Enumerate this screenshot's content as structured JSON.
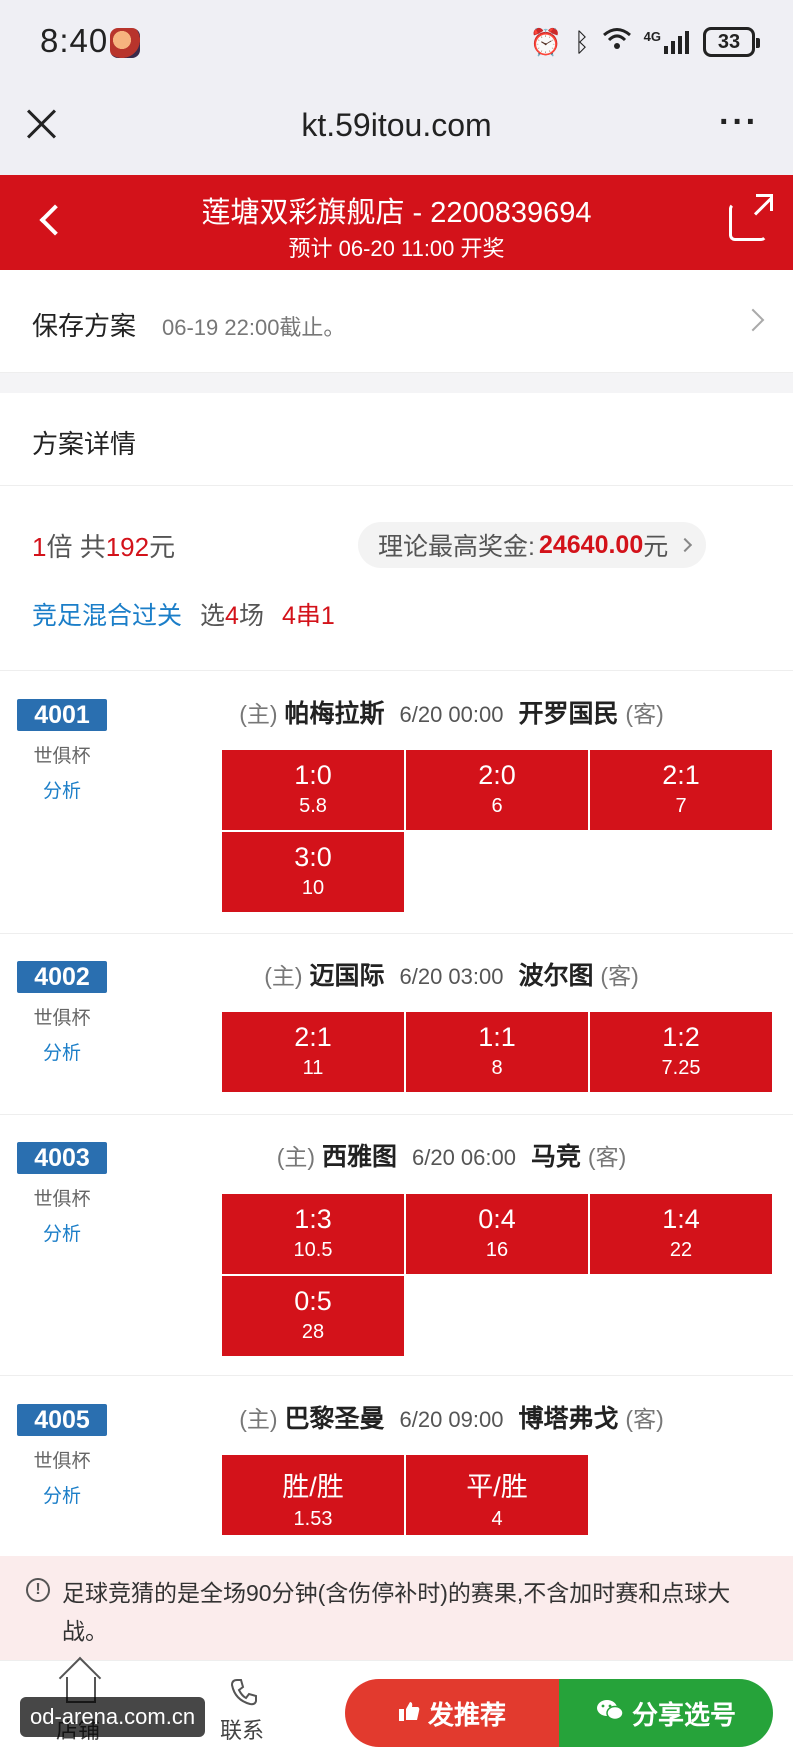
{
  "status_bar": {
    "time": "8:40",
    "network": "4G",
    "battery": "33"
  },
  "url_bar": {
    "url": "kt.59itou.com",
    "more": "···"
  },
  "header": {
    "title": "莲塘双彩旗舰店 - 2200839694",
    "subtitle": "预计 06-20 11:00 开奖"
  },
  "save_row": {
    "title": "保存方案",
    "deadline": "06-19 22:00截止。"
  },
  "detail": {
    "title": "方案详情",
    "multiplier": "1",
    "multiplier_unit": "倍 共",
    "amount": "192",
    "amount_unit": "元",
    "prize_label": "理论最高奖金:",
    "prize_value": "24640.00",
    "prize_unit": "元",
    "mode": "竞足混合过关",
    "select_pre": "选",
    "select_count": "4",
    "select_post": "场",
    "combo": "4串1"
  },
  "matches": [
    {
      "no": "4001",
      "league": "世俱杯",
      "analysis": "分析",
      "home_tag": "(主)",
      "home": "帕梅拉斯",
      "time": "6/20 00:00",
      "away": "开罗国民",
      "away_tag": "(客)",
      "picks": [
        {
          "score": "1:0",
          "odds": "5.8"
        },
        {
          "score": "2:0",
          "odds": "6"
        },
        {
          "score": "2:1",
          "odds": "7"
        },
        {
          "score": "3:0",
          "odds": "10"
        }
      ]
    },
    {
      "no": "4002",
      "league": "世俱杯",
      "analysis": "分析",
      "home_tag": "(主)",
      "home": "迈国际",
      "time": "6/20 03:00",
      "away": "波尔图",
      "away_tag": "(客)",
      "picks": [
        {
          "score": "2:1",
          "odds": "11"
        },
        {
          "score": "1:1",
          "odds": "8"
        },
        {
          "score": "1:2",
          "odds": "7.25"
        }
      ]
    },
    {
      "no": "4003",
      "league": "世俱杯",
      "analysis": "分析",
      "home_tag": "(主)",
      "home": "西雅图",
      "time": "6/20 06:00",
      "away": "马竞",
      "away_tag": "(客)",
      "picks": [
        {
          "score": "1:3",
          "odds": "10.5"
        },
        {
          "score": "0:4",
          "odds": "16"
        },
        {
          "score": "1:4",
          "odds": "22"
        },
        {
          "score": "0:5",
          "odds": "28"
        }
      ]
    },
    {
      "no": "4005",
      "league": "世俱杯",
      "analysis": "分析",
      "home_tag": "(主)",
      "home": "巴黎圣曼",
      "time": "6/20 09:00",
      "away": "博塔弗戈",
      "away_tag": "(客)",
      "picks": [
        {
          "score": "胜/胜",
          "odds": "1.53"
        },
        {
          "score": "平/胜",
          "odds": "4"
        }
      ]
    }
  ],
  "notice": {
    "text": "足球竞猜的是全场90分钟(含伤停补时)的赛果,不含加时赛和点球大战。"
  },
  "bottom_bar": {
    "store": "店铺",
    "contact": "联系",
    "recommend": "发推荐",
    "share": "分享选号"
  },
  "watermark": "od-arena.com.cn",
  "colors": {
    "brand_red": "#d3121a",
    "link_blue": "#1b7ec8",
    "badge_blue": "#2a6fb0",
    "share_green": "#26a33a"
  },
  "icons": [
    "close-icon",
    "more-icon",
    "back-icon",
    "share-icon",
    "chevron-right-icon",
    "info-icon",
    "store-icon",
    "phone-icon",
    "thumbs-up-icon",
    "wechat-icon",
    "wifi-icon",
    "bluetooth-icon",
    "alarm-icon",
    "signal-icon"
  ]
}
